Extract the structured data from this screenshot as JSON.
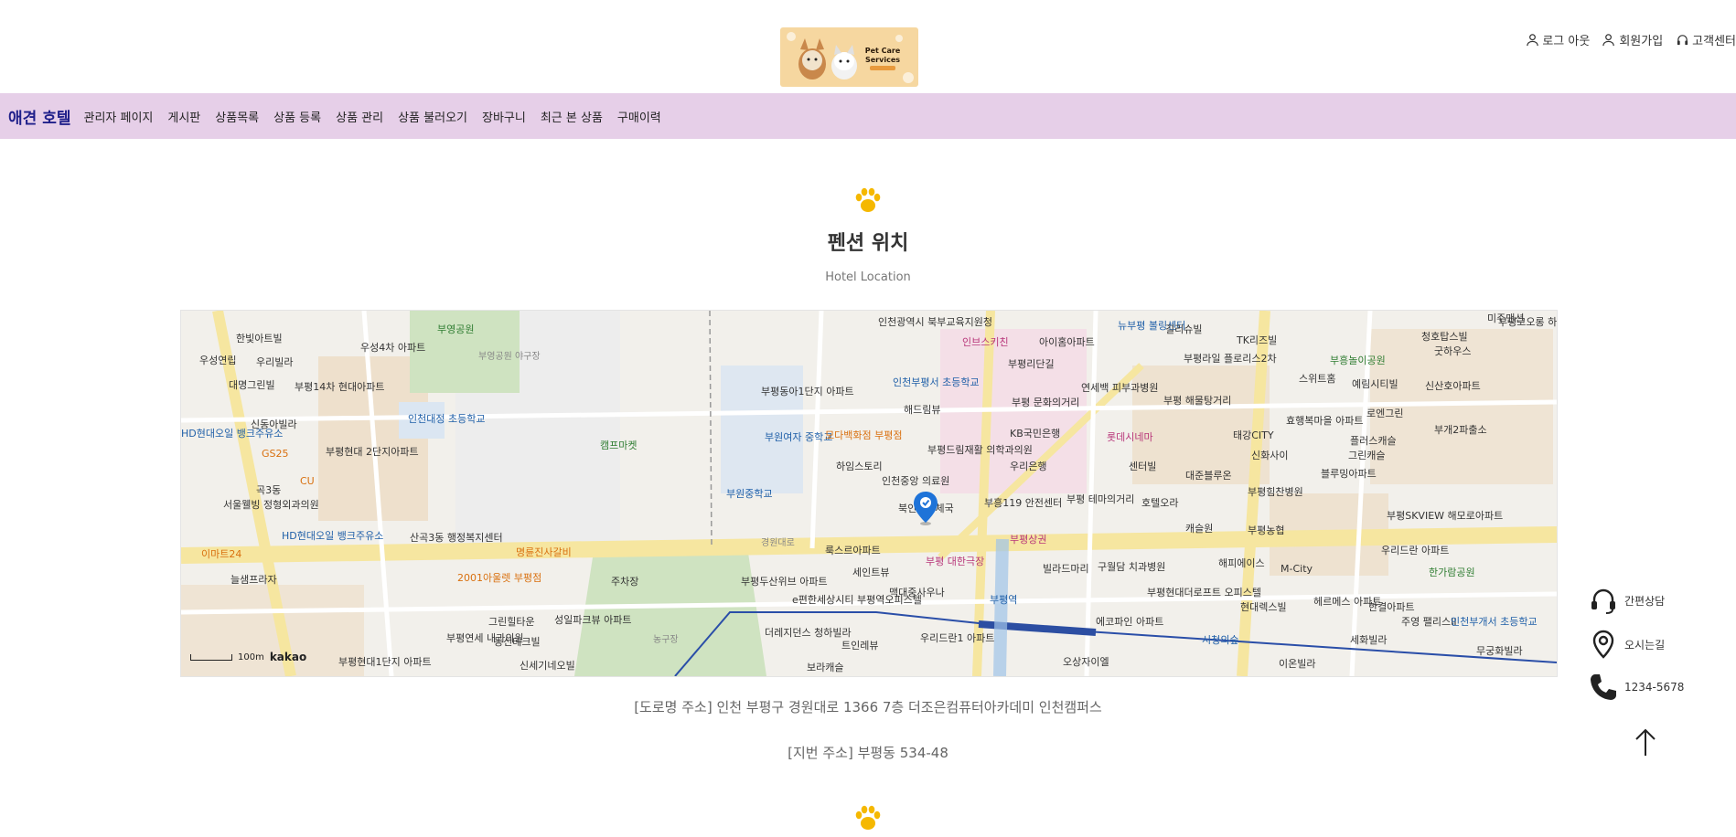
{
  "header": {
    "links": [
      {
        "label": "로그 아웃",
        "icon": "user-icon"
      },
      {
        "label": "회원가입",
        "icon": "user-add-icon"
      },
      {
        "label": "고객센터",
        "icon": "headset-icon"
      }
    ],
    "logo": {
      "text_line1": "Pet Care",
      "text_line2": "Services"
    }
  },
  "nav": {
    "brand": "애견 호텔",
    "items": [
      "관리자 페이지",
      "게시판",
      "상품목록",
      "상품 등록",
      "상품 관리",
      "상품 불러오기",
      "장바구니",
      "최근 본 상품",
      "구매이력"
    ]
  },
  "section": {
    "title": "펜션 위치",
    "subtitle": "Hotel Location"
  },
  "map": {
    "scale_label": "100m",
    "provider": "kakao",
    "labels": [
      "인천광역시 북부교육지원청",
      "부영공원",
      "우성4차 아파트",
      "한빛아트빌",
      "우성연립",
      "우리빌라",
      "부영공원 야구장",
      "대명그린빌",
      "부평14차 현대아파트",
      "인천대정 초등학교",
      "신동아빌라",
      "HD현대오일 뱅크주유소",
      "GS25",
      "부평현대 2단지아파트",
      "CU",
      "곡3동",
      "서울웰빙 정형외과의원",
      "캠프마켓",
      "HD현대오일 뱅크주유소",
      "이마트24",
      "산곡3동 행정복지센터",
      "명륜진사갈비",
      "2001아울렛 부평점",
      "늘샘프라자",
      "그린힐타운",
      "성일파크뷰 아파트",
      "부평연세 내과의원",
      "동신테크빌",
      "신세기네오빌",
      "부평현대1단지 아파트",
      "부평동아1단지 아파트",
      "부원여자 중학교",
      "모다백화점 부평점",
      "부원중학교",
      "하임스토리",
      "인천부평서 초등학교",
      "해드림뷰",
      "인천중앙 의료원",
      "북인천우체국",
      "부평드림재활 의학과의원",
      "KB국민은행",
      "우리은행",
      "부평 문화의거리",
      "부평리단길",
      "아이홈아파트",
      "뉴부평 볼링센터",
      "인브스키친",
      "연세백 피부과병원",
      "롯데시네마",
      "부흥119 안전센터",
      "부평 테마의거리",
      "센터빌",
      "호텔오라",
      "대준블루온",
      "길리슈빌",
      "TK리즈빌",
      "부평라일 플로리스2차",
      "부평 해물탕거리",
      "태강CITY",
      "신화사이",
      "효행복마을 아파트",
      "부평힘찬병원",
      "블루밍아파트",
      "플러스캐슬",
      "그린캐슬",
      "로엔그린",
      "부개2파출소",
      "부흥놀이공원",
      "스위트홈",
      "예림시티빌",
      "신산호아파트",
      "청호탑스빌",
      "굿하우스",
      "미주맨션",
      "부평코오롱 하늘채아파트",
      "경원대로",
      "룩스르아파트",
      "세인트뷰",
      "부평두산위브 아파트",
      "e편한세상시티 부평역오피스텔",
      "맥대중사우나",
      "부평 대한극장",
      "부평역",
      "빌라드마리",
      "구월담 치과병원",
      "에코파인 아파트",
      "부평현대더로프트 오피스텔",
      "해피에이스",
      "M-City",
      "캐슬원",
      "부평농협",
      "부평SKVIEW 해모로아파트",
      "우리드란 아파트",
      "한가람공원",
      "현대렉스빌",
      "헤르메스 아파트",
      "한결아파트",
      "주영 팰리스II",
      "인천부개서 초등학교",
      "세화빌라",
      "무궁화빌라",
      "이온빌라",
      "오상자이엘",
      "우리드란1 아파트",
      "트인레뷰",
      "더레지던스 청하빌라",
      "보라캐슬",
      "농구장",
      "주차장",
      "시청의숲",
      "부평상권"
    ]
  },
  "address": {
    "road": "[도로명 주소] 인천 부평구 경원대로 1366 7층 더조은컴퓨터아카데미 인천캠퍼스",
    "lot": "[지번 주소] 부평동 534-48"
  },
  "sidebar": {
    "items": [
      {
        "label": "간편상담",
        "icon": "headset-icon"
      },
      {
        "label": "오시는길",
        "icon": "location-pin-icon"
      },
      {
        "label": "1234-5678",
        "icon": "phone-icon"
      }
    ],
    "top_icon": "arrow-up-icon"
  },
  "colors": {
    "nav_bg": "#e6cfe8",
    "brand": "#1f1f8a",
    "paw": "#f5b800",
    "map_marker": "#1e73d8"
  }
}
